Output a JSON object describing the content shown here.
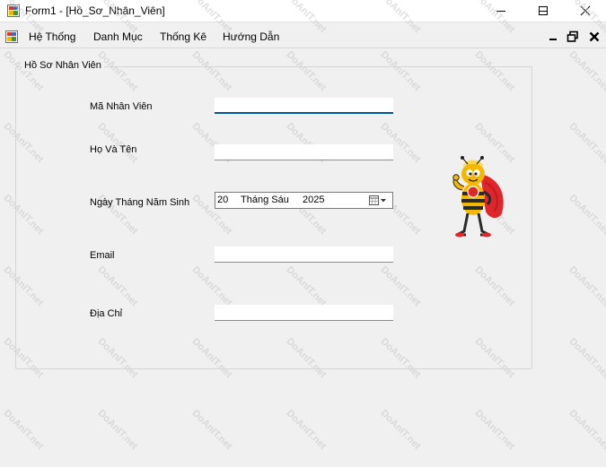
{
  "window": {
    "title": "Form1 - [Hồ_Sơ_Nhân_Viên]",
    "minimize_icon": "minimize-icon",
    "maximize_icon": "maximize-icon",
    "close_icon": "close-icon"
  },
  "menubar": {
    "items": [
      {
        "label": "Hệ Thống"
      },
      {
        "label": "Danh Mục"
      },
      {
        "label": "Thống Kê"
      },
      {
        "label": "Hướng Dẫn"
      }
    ]
  },
  "form": {
    "group_title": "Hồ Sơ Nhân Viên",
    "fields": {
      "employee_id": {
        "label": "Mã Nhân Viên",
        "value": ""
      },
      "full_name": {
        "label": "Họ Và Tên",
        "value": ""
      },
      "birth_date": {
        "label": "Ngày Tháng Năm Sinh",
        "day": "20",
        "month": "Tháng Sáu",
        "year": "2025"
      },
      "email": {
        "label": "Email",
        "value": ""
      },
      "address": {
        "label": "Địa Chỉ",
        "value": ""
      }
    }
  },
  "watermark": {
    "text": "DoAnIT.net"
  },
  "colors": {
    "background": "#f0f0f0",
    "focus_underline": "#005499",
    "mascot_cape": "#e0262b",
    "mascot_body": "#f5b800"
  }
}
